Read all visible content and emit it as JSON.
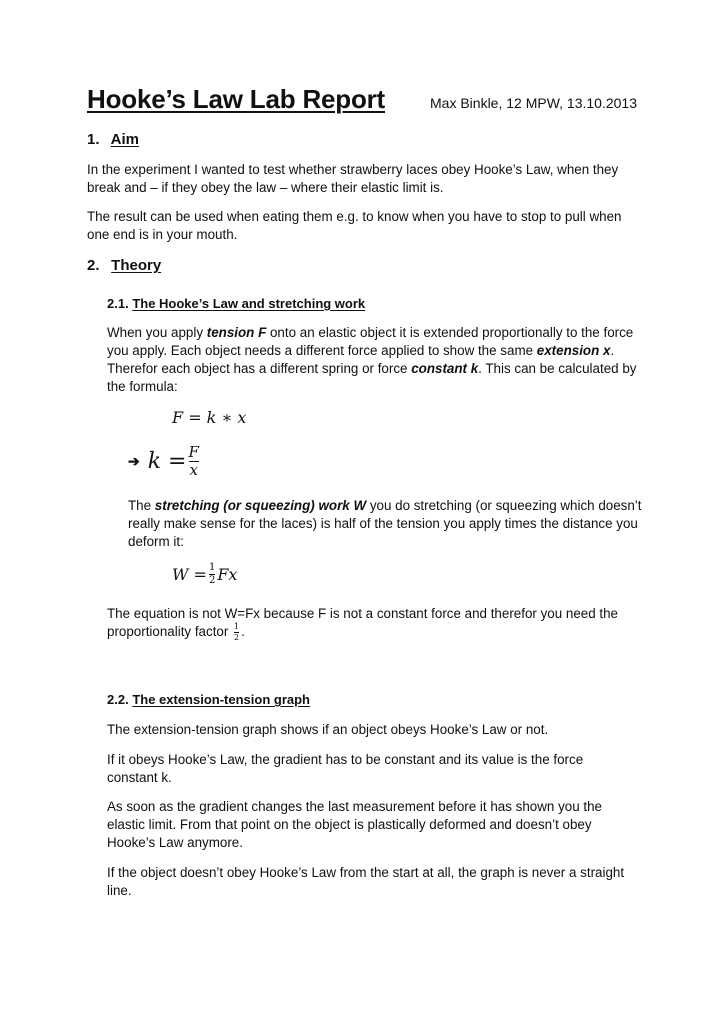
{
  "header": {
    "title": "Hooke’s Law Lab Report",
    "byline": "Max Binkle, 12 MPW, 13.10.2013"
  },
  "sections": [
    {
      "number": "1.",
      "title": "Aim",
      "paragraphs": [
        "In the experiment I wanted to test whether strawberry laces obey Hooke’s Law, when they break and – if they obey the law – where their elastic limit is.",
        "The result can be used when eating them e.g. to know when you have to stop to pull when one end is in your mouth."
      ]
    },
    {
      "number": "2.",
      "title": "Theory",
      "subsections": [
        {
          "number": "2.1.",
          "title": "The Hooke’s Law and stretching work",
          "p1": {
            "a": "When you apply ",
            "b1": "tension F",
            "c": " onto an elastic object it is extended proportionally to the force you apply. Each object needs a different force applied to show the same ",
            "b2": "extension x",
            "d": ". Therefor each object has a different spring or force ",
            "b3": "constant k",
            "e": ". This can be calculated by the formula:"
          },
          "formula1": "F = k ∗ x",
          "arrow": "➔",
          "formula2": {
            "lhs": "k =",
            "num": "F",
            "den": "x"
          },
          "p2": {
            "a": "The ",
            "b1": "stretching (or squeezing) work W",
            "c": " you do stretching (or squeezing which doesn’t really make sense for the laces) is half of the tension you apply times the distance you deform it:"
          },
          "formula3": {
            "lhs": "W =",
            "num": "1",
            "den": "2",
            "rhs": "Fx"
          },
          "p3": {
            "a": "The equation is not W=Fx because F is not a constant force and therefor you need the proportionality factor ",
            "num": "1",
            "den": "2",
            "end": "."
          }
        },
        {
          "number": "2.2.",
          "title": "The extension-tension graph",
          "paragraphs": [
            "The extension-tension graph shows if an object obeys Hooke’s Law or not.",
            "If it obeys Hooke’s Law, the gradient has to be constant and its value is the force constant k.",
            "As soon as the gradient changes the last measurement before it has shown you the elastic limit. From that point on the object is plastically deformed and doesn’t obey Hooke’s Law anymore.",
            "If the object doesn’t obey Hooke’s Law from the start at all, the graph is never a straight line."
          ]
        }
      ]
    }
  ]
}
